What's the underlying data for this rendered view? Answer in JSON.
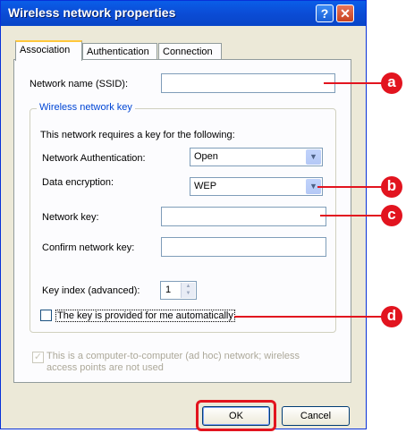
{
  "window": {
    "title": "Wireless network properties",
    "help_glyph": "?",
    "close_glyph": "✕"
  },
  "tabs": [
    {
      "label": "Association",
      "active": true
    },
    {
      "label": "Authentication",
      "active": false
    },
    {
      "label": "Connection",
      "active": false
    }
  ],
  "association": {
    "ssid_label": "Network name (SSID):",
    "ssid_value": "",
    "group_title": "Wireless network key",
    "requires_key_text": "This network requires a key for the following:",
    "auth_label": "Network Authentication:",
    "auth_value": "Open",
    "encryption_label": "Data encryption:",
    "encryption_value": "WEP",
    "network_key_label": "Network key:",
    "network_key_value": "",
    "confirm_key_label": "Confirm network key:",
    "confirm_key_value": "",
    "key_index_label": "Key index (advanced):",
    "key_index_value": "1",
    "auto_key_label": "The key is provided for me automatically",
    "auto_key_checked": false,
    "adhoc_line1": "This is a computer-to-computer (ad hoc) network; wireless",
    "adhoc_line2": "access points are not used",
    "adhoc_checked": true
  },
  "buttons": {
    "ok": "OK",
    "cancel": "Cancel"
  },
  "callouts": {
    "a": "a",
    "b": "b",
    "c": "c",
    "d": "d"
  },
  "colors": {
    "callout_red": "#e2141f",
    "titlebar_blue": "#0b4cd6"
  },
  "icons": {
    "help": "question-mark-icon",
    "close": "close-icon",
    "dropdown": "chevron-down-icon",
    "spinner": "spinner-arrows-icon"
  }
}
